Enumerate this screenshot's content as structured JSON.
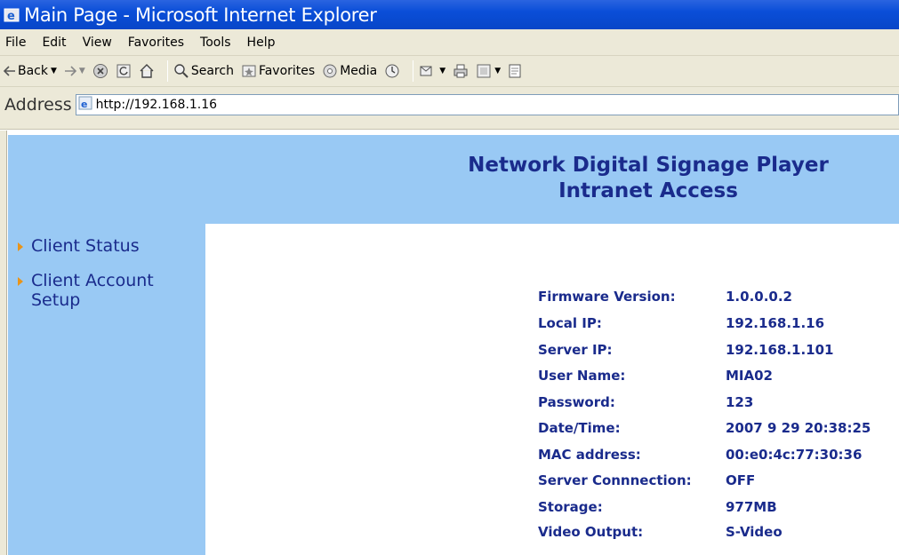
{
  "window": {
    "title": "Main Page - Microsoft Internet Explorer",
    "icon": "ie-icon"
  },
  "menu": [
    "File",
    "Edit",
    "View",
    "Favorites",
    "Tools",
    "Help"
  ],
  "toolbar": {
    "back_label": "Back",
    "search_label": "Search",
    "favorites_label": "Favorites",
    "media_label": "Media"
  },
  "address": {
    "label": "Address",
    "url": "http://192.168.1.16"
  },
  "banner": {
    "title_line1": "Network Digital Signage Player",
    "title_line2": "Intranet Access"
  },
  "sidebar": {
    "items": [
      {
        "label": "Client Status"
      },
      {
        "label_line1": "Client Account",
        "label_line2": "Setup"
      }
    ]
  },
  "info": [
    {
      "key": "Firmware Version:",
      "value": "1.0.0.0.2"
    },
    {
      "key": "Local IP:",
      "value": "192.168.1.16"
    },
    {
      "key": "Server IP:",
      "value": "192.168.1.101"
    },
    {
      "key": "User Name:",
      "value": "MIA02"
    },
    {
      "key": "Password:",
      "value": "123"
    },
    {
      "key": "Date/Time:",
      "value": "2007 9 29 20:38:25"
    },
    {
      "key": "MAC address:",
      "value": "00:e0:4c:77:30:36"
    },
    {
      "key": "Server Connnection:",
      "value": "OFF"
    },
    {
      "key": "Storage:",
      "value": "977MB"
    },
    {
      "key": "Video Output:",
      "value": "S-Video"
    }
  ],
  "colors": {
    "banner_bg": "#99c9f4",
    "text_navy": "#1a2b8c",
    "bullet_orange": "#e8941a"
  }
}
